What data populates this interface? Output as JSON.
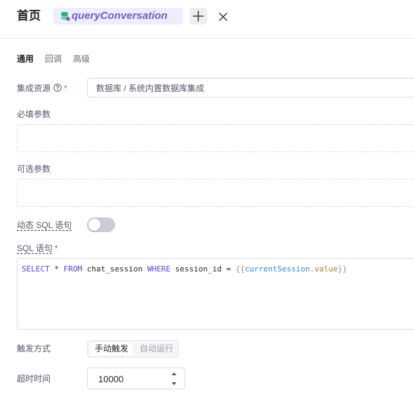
{
  "header": {
    "title": "首页",
    "active_tab_label": "queryConversation"
  },
  "tabs": [
    {
      "label": "通用",
      "active": true
    },
    {
      "label": "回调",
      "active": false
    },
    {
      "label": "高级",
      "active": false
    }
  ],
  "form": {
    "resource_label": "集成资源",
    "resource_required": "*",
    "resource_placeholder": "数据库 / 系统内置数据库集成",
    "required_params_label": "必填参数",
    "optional_params_label": "可选参数",
    "dynamic_sql_label": "动态 SQL 语句",
    "dynamic_sql_enabled": false,
    "sql_label": "SQL 语句",
    "sql_required": "*",
    "sql_tokens": [
      {
        "text": "SELECT",
        "type": "kw"
      },
      {
        "text": " * ",
        "type": "plain"
      },
      {
        "text": "FROM",
        "type": "kw"
      },
      {
        "text": " chat_session ",
        "type": "plain"
      },
      {
        "text": "WHERE",
        "type": "kw"
      },
      {
        "text": " session_id = ",
        "type": "plain"
      },
      {
        "text": "{{",
        "type": "brace"
      },
      {
        "text": "currentSession.",
        "type": "tpl"
      },
      {
        "text": "value",
        "type": "prop"
      },
      {
        "text": "}}",
        "type": "brace"
      }
    ],
    "trigger_label": "触发方式",
    "trigger_options": [
      "手动触发",
      "自动运行"
    ],
    "trigger_selected": "手动触发",
    "timeout_label": "超时时间",
    "timeout_value": "10000"
  },
  "colors": {
    "accent_purple": "#7a58c8",
    "sql_keyword": "#5b3ee8",
    "required": "#f53f3f"
  }
}
